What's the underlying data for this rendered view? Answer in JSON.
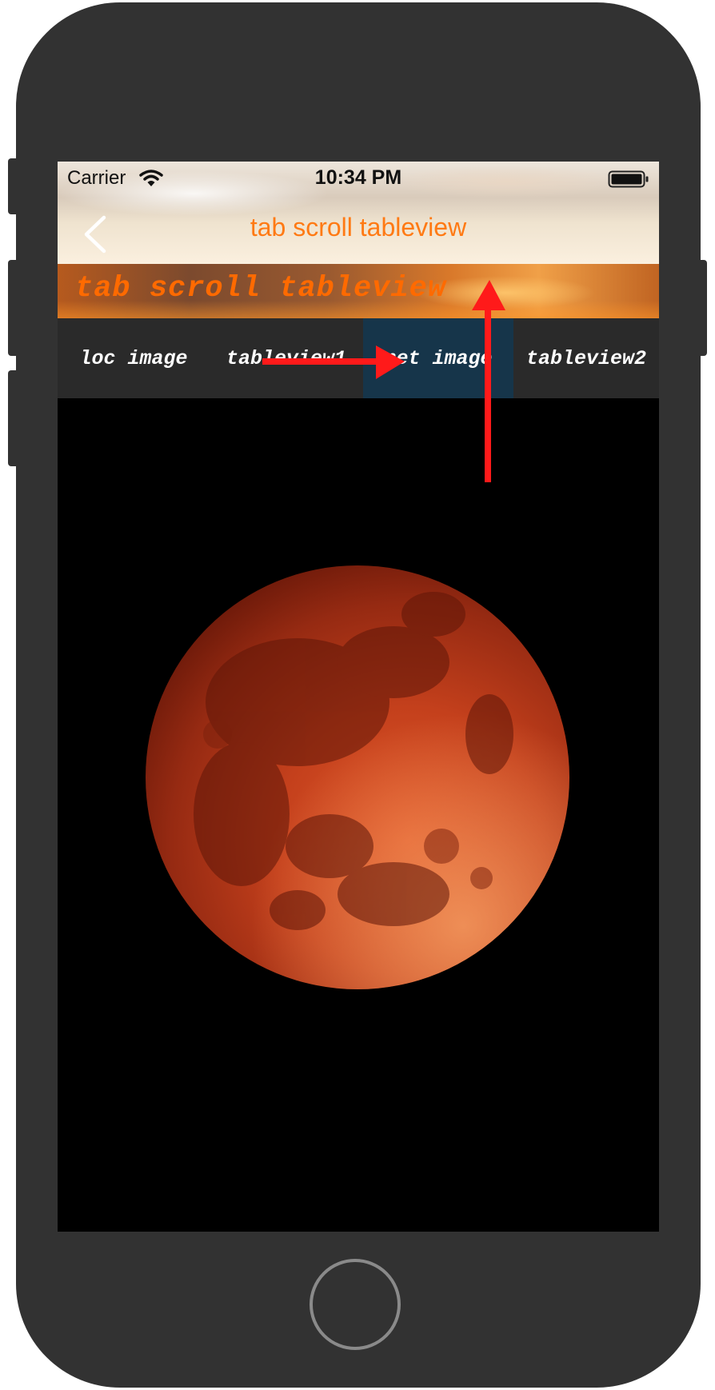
{
  "status_bar": {
    "carrier": "Carrier",
    "time": "10:34 PM"
  },
  "nav": {
    "title": "tab scroll tableview"
  },
  "header": {
    "title": "tab scroll tableview"
  },
  "tabs": [
    {
      "label": "loc image",
      "active": false
    },
    {
      "label": "tableview1",
      "active": false
    },
    {
      "label": "net image",
      "active": true
    },
    {
      "label": "tableview2",
      "active": false
    }
  ],
  "colors": {
    "accent": "#ff7a14",
    "banner_text": "#ff6a00",
    "tab_active_bg": "#16354a",
    "tabbar_bg": "#2a2a2a",
    "annotation_arrow": "#ff0000"
  },
  "icons": {
    "wifi": "wifi-icon",
    "battery": "battery-icon",
    "back": "chevron-left-icon"
  }
}
